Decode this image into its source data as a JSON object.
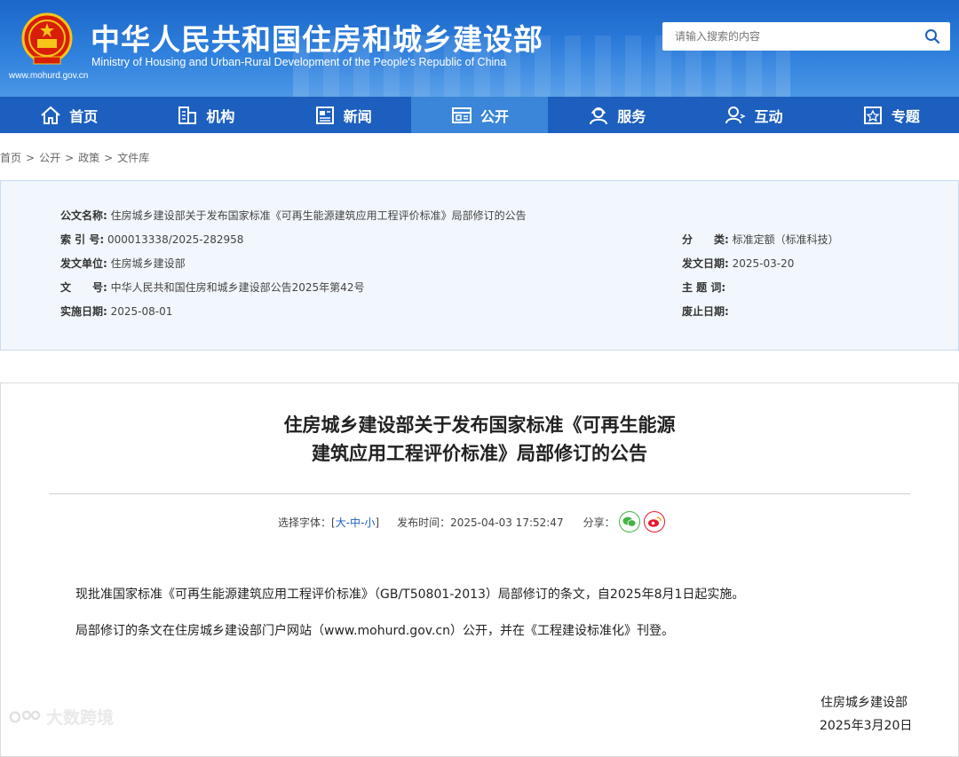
{
  "header": {
    "site_url": "www.mohurd.gov.cn",
    "title_cn": "中华人民共和国住房和城乡建设部",
    "title_en": "Ministry of Housing and Urban-Rural Development of the People's Republic of China",
    "search_placeholder": "请输入搜索的内容"
  },
  "nav": {
    "items": [
      {
        "label": "首页",
        "icon": "home-icon"
      },
      {
        "label": "机构",
        "icon": "building-icon"
      },
      {
        "label": "新闻",
        "icon": "news-icon"
      },
      {
        "label": "公开",
        "icon": "public-icon"
      },
      {
        "label": "服务",
        "icon": "service-icon"
      },
      {
        "label": "互动",
        "icon": "interact-icon"
      },
      {
        "label": "专题",
        "icon": "topic-icon"
      }
    ],
    "active_index": 3
  },
  "breadcrumb": [
    "首页",
    "公开",
    "政策",
    "文件库"
  ],
  "breadcrumb_sep": ">",
  "meta": {
    "doc_name_label": "公文名称:",
    "doc_name": "住房城乡建设部关于发布国家标准《可再生能源建筑应用工程评价标准》局部修订的公告",
    "index_label": "索 引 号:",
    "index": "000013338/2025-282958",
    "category_label": "分　　类:",
    "category": "标准定额（标准科技）",
    "issuer_label": "发文单位:",
    "issuer": "住房城乡建设部",
    "issue_date_label": "发文日期:",
    "issue_date": "2025-03-20",
    "doc_no_label": "文　　号:",
    "doc_no": "中华人民共和国住房和城乡建设部公告2025年第42号",
    "keywords_label": "主 题 词:",
    "keywords": "",
    "effective_label": "实施日期:",
    "effective": "2025-08-01",
    "repeal_label": "废止日期:",
    "repeal": ""
  },
  "article": {
    "title_line1": "住房城乡建设部关于发布国家标准《可再生能源",
    "title_line2": "建筑应用工程评价标准》局部修订的公告",
    "font_select_label": "选择字体：[",
    "font_large": "大",
    "font_medium": "中",
    "font_small": "小",
    "font_select_end": "]",
    "font_dash": "-",
    "publish_label": "发布时间：",
    "publish_time": "2025-04-03 17:52:47",
    "share_label": "分享：",
    "para1": "现批准国家标准《可再生能源建筑应用工程评价标准》（GB/T50801-2013）局部修订的条文，自2025年8月1日起实施。",
    "para2": "局部修订的条文在住房城乡建设部门户网站（www.mohurd.gov.cn）公开，并在《工程建设标准化》刊登。",
    "sign_org": "住房城乡建设部",
    "sign_date": "2025年3月20日"
  },
  "watermark": "大数跨境",
  "colors": {
    "header_blue": "#2f80dd",
    "nav_blue": "#1d5fbf",
    "nav_active": "#3b86d8",
    "link_blue": "#1a5fc2",
    "meta_bg": "#f2f7fd"
  }
}
